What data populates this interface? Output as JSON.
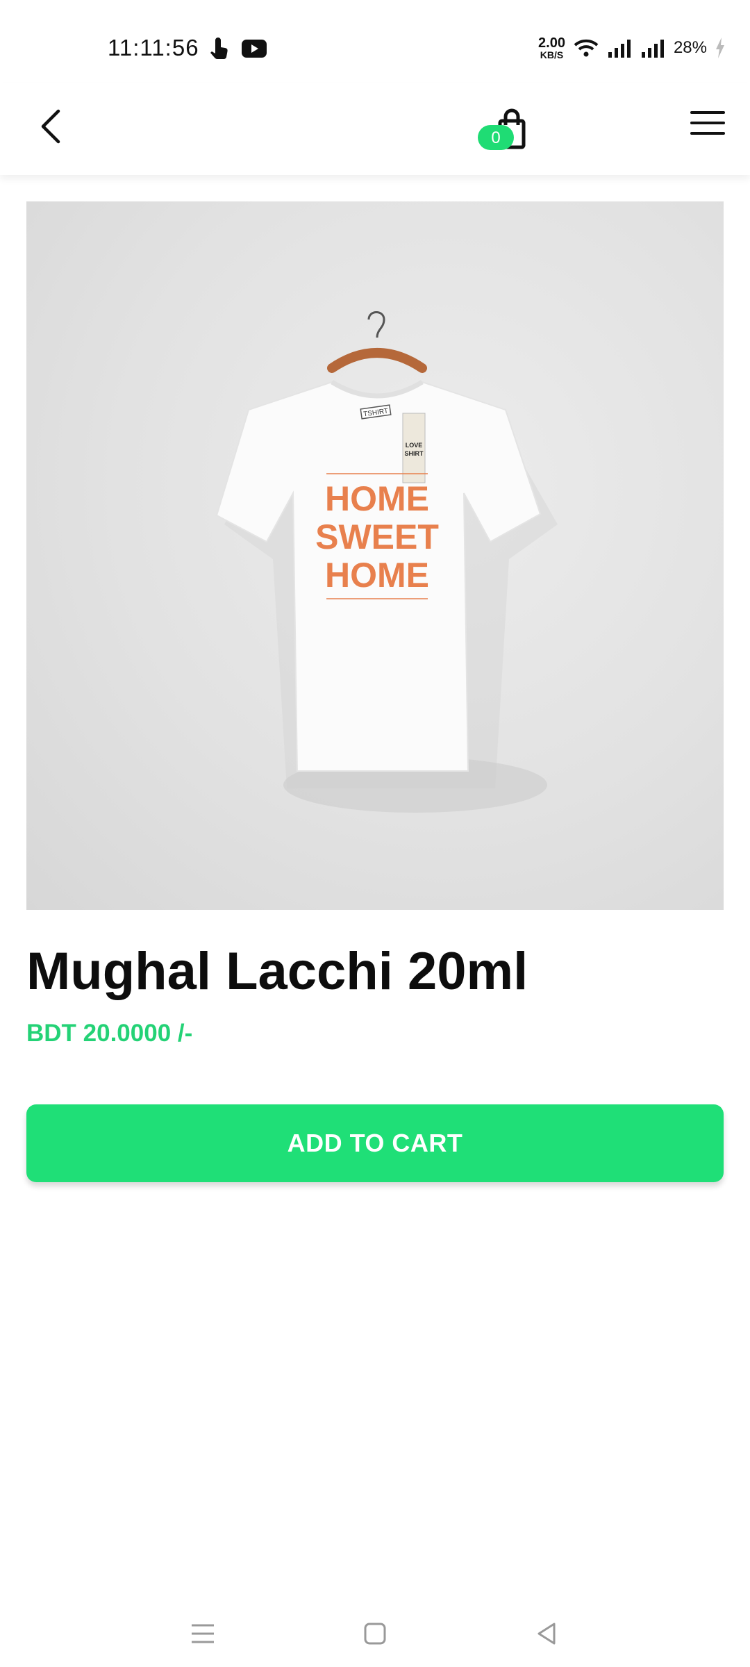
{
  "status_bar": {
    "time": "11:11:56",
    "net_speed_value": "2.00",
    "net_speed_unit": "KB/S",
    "battery": "28%"
  },
  "app_bar": {
    "cart_count": "0"
  },
  "product": {
    "image_text": [
      "HOME",
      "SWEET",
      "HOME"
    ],
    "tag_text": [
      "LOVE",
      "SHIRT"
    ],
    "neck_label": "TSHIRT",
    "title": "Mughal Lacchi 20ml",
    "price": "BDT 20.0000 /-",
    "add_to_cart_label": "ADD TO CART"
  },
  "colors": {
    "accent": "#1fdc74",
    "print": "#e8804d"
  },
  "icons": {
    "status_left": [
      "touch-icon",
      "youtube-icon"
    ],
    "status_right": [
      "wifi-icon",
      "signal-icon",
      "signal-icon",
      "charging-icon"
    ],
    "app_bar": [
      "back-arrow-icon",
      "shopping-bag-icon",
      "hamburger-menu-icon"
    ],
    "nav": [
      "recents-icon",
      "home-icon",
      "back-icon"
    ]
  }
}
